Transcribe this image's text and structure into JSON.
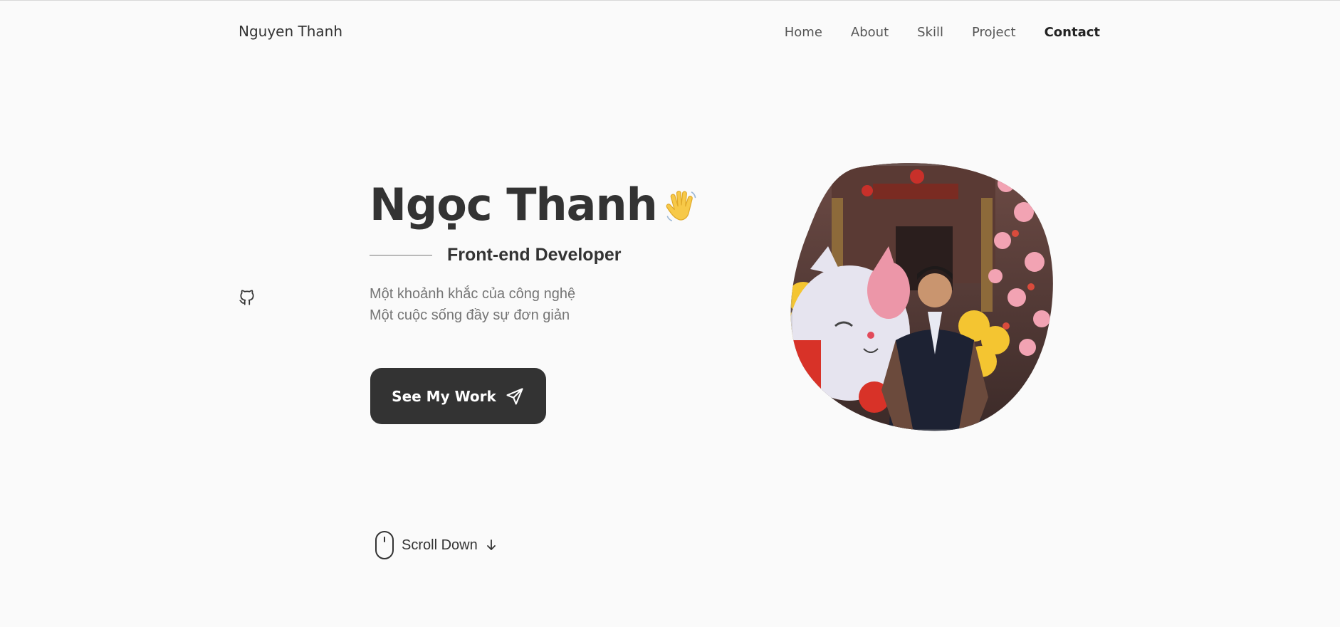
{
  "header": {
    "logo": "Nguyen Thanh",
    "nav": [
      {
        "label": "Home"
      },
      {
        "label": "About"
      },
      {
        "label": "Skill"
      },
      {
        "label": "Project"
      },
      {
        "label": "Contact"
      }
    ],
    "active_nav": "Contact"
  },
  "social": {
    "icon": "github-icon"
  },
  "hero": {
    "name": "Ngọc Thanh",
    "wave_icon": "waving-hand-icon",
    "role": "Front-end Developer",
    "description_line1": "Một khoảnh khắc của công nghệ",
    "description_line2": "Một cuộc sống đầy sự đơn giản",
    "cta_label": "See My Work",
    "cta_icon": "send-icon",
    "photo_icon": "profile-photo"
  },
  "scroll": {
    "label": "Scroll Down",
    "icon": "mouse-icon",
    "arrow_icon": "arrow-down-icon"
  },
  "colors": {
    "background": "#fafafa",
    "text": "#333333",
    "muted": "#757575",
    "button": "#333333"
  }
}
